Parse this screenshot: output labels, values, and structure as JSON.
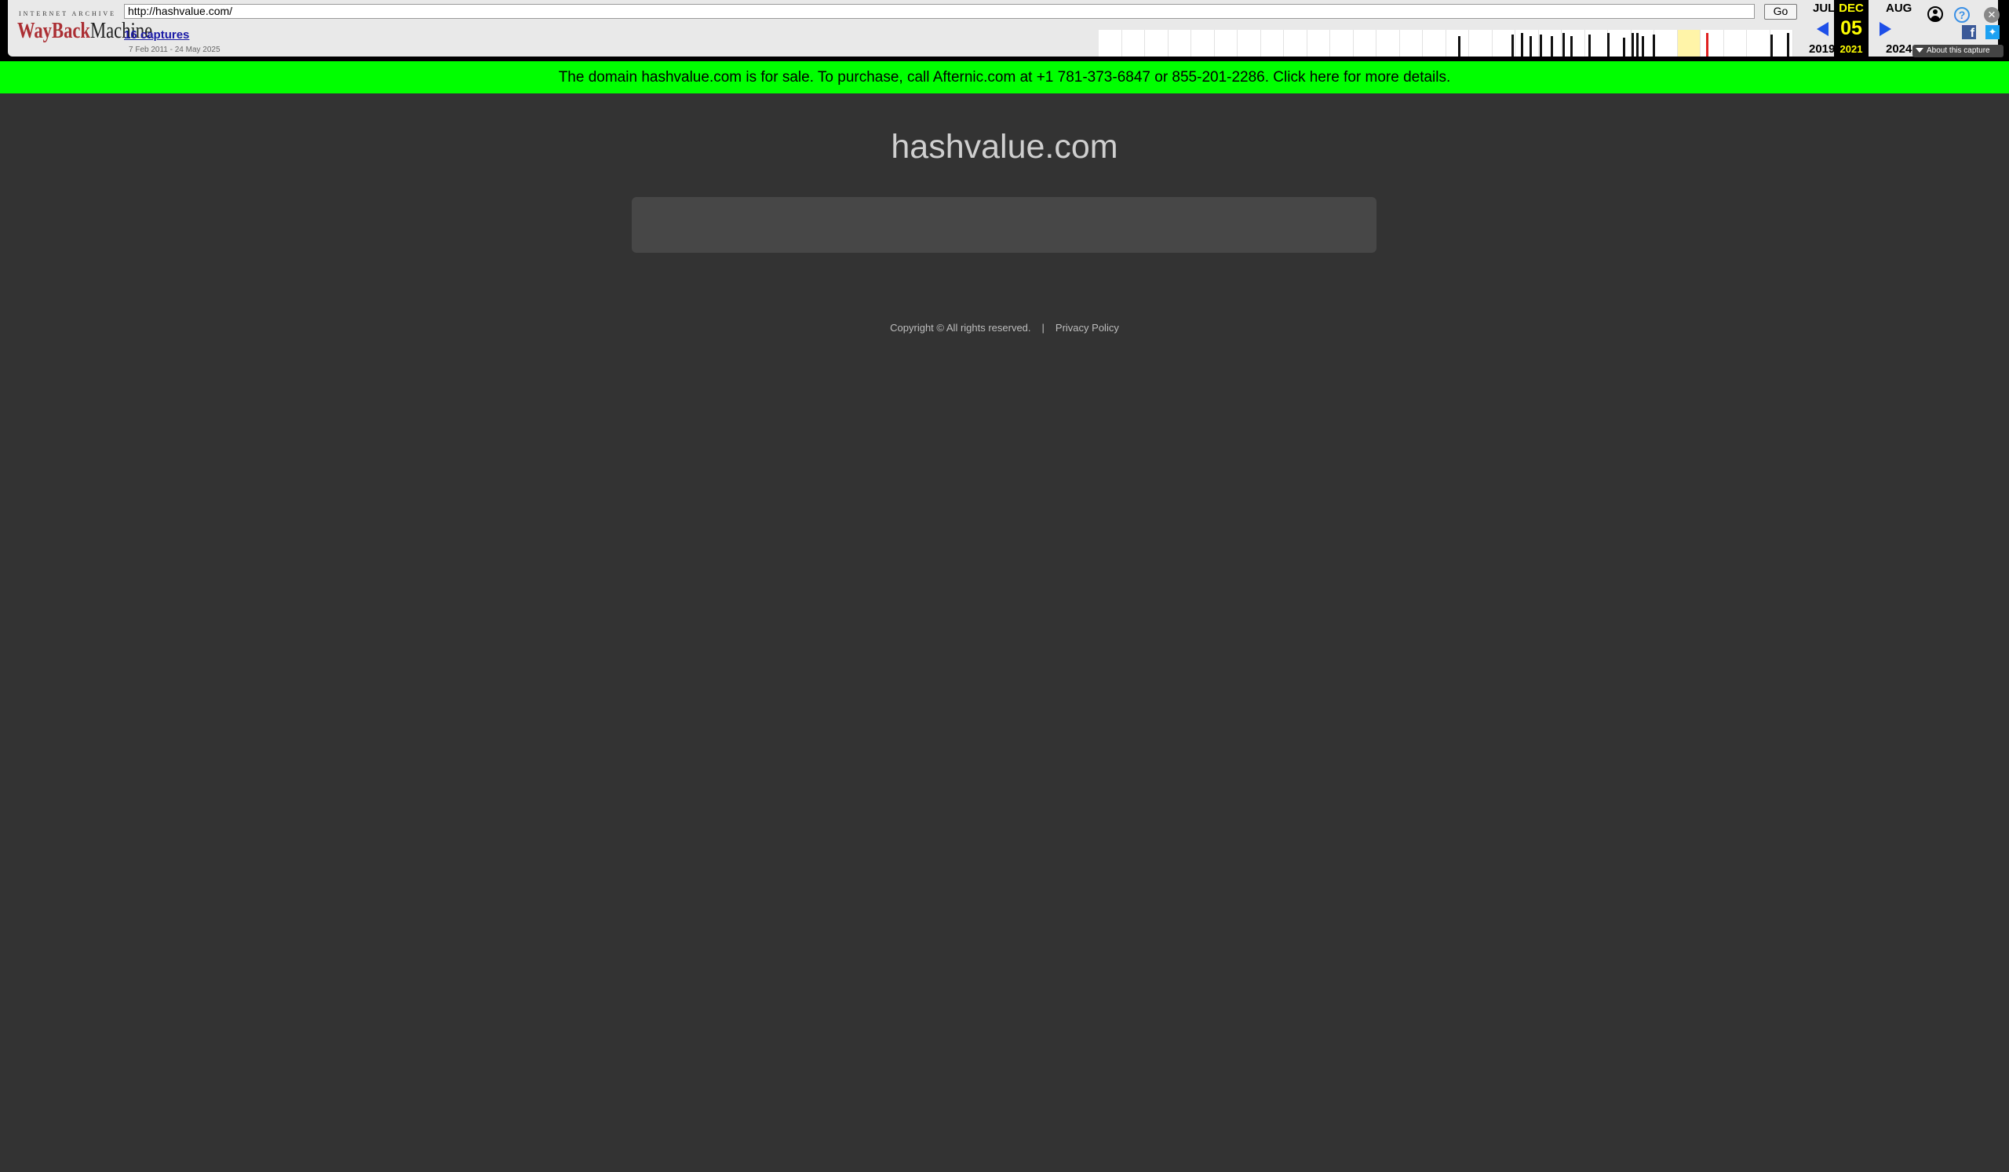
{
  "wayback": {
    "url": "http://hashvalue.com/",
    "go_label": "Go",
    "captures_label": "16 captures",
    "date_range": "7 Feb 2011 - 24 May 2025",
    "logo_top": "INTERNET ARCHIVE",
    "logo_word_1": "WayBack",
    "logo_word_2": "Machine",
    "prev_month": "JUL",
    "prev_year": "2019",
    "cur_month": "DEC",
    "cur_day": "05",
    "cur_year": "2021",
    "next_month": "AUG",
    "next_year": "2024",
    "about_label": "About this capture",
    "icons": [
      "user-icon",
      "help-icon",
      "close-icon",
      "facebook-icon",
      "twitter-icon"
    ]
  },
  "banner": {
    "text": "The domain hashvalue.com is for sale. To purchase, call Afternic.com at +1 781-373-6847 or 855-201-2286. Click here for more details.",
    "color": "#00ff00"
  },
  "main": {
    "title": "hashvalue.com"
  },
  "footer": {
    "copyright": "Copyright © All rights reserved.",
    "separator": "|",
    "privacy": "Privacy Policy"
  }
}
